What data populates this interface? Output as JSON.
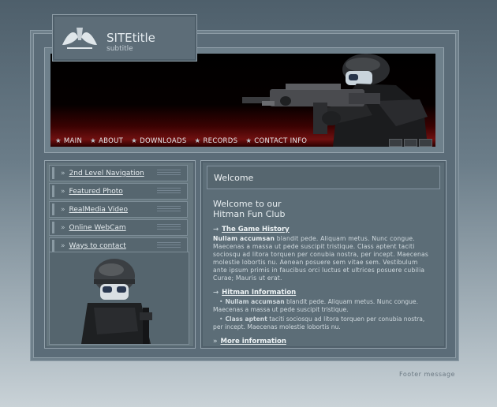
{
  "site": {
    "title": "SITEtitle",
    "subtitle": "subtitle"
  },
  "nav": {
    "items": [
      {
        "label": "MAIN"
      },
      {
        "label": "ABOUT"
      },
      {
        "label": "DOWNLOADS"
      },
      {
        "label": "RECORDS"
      },
      {
        "label": "CONTACT INFO"
      }
    ]
  },
  "sidebar": {
    "items": [
      {
        "label": "2nd Level Navigation"
      },
      {
        "label": "Featured Photo"
      },
      {
        "label": "RealMedia Video"
      },
      {
        "label": "Online WebCam"
      },
      {
        "label": "Ways to contact"
      }
    ]
  },
  "main": {
    "heading": "Welcome",
    "intro_title_line1": "Welcome to our",
    "intro_title_line2": "Hitman Fun Club",
    "section1": {
      "link": "The Game History",
      "bold": "Nullam accumsan",
      "text": " blandit pede. Aliquam metus. Nunc congue. Maecenas a massa ut pede suscipit tristique. Class aptent taciti sociosqu ad litora torquen per conubia nostra, per incept. Maecenas molestie lobortis nu. Aenean posuere sem vitae sem. Vestibulum ante ipsum primis in faucibus orci luctus et ultrices posuere cubilia Curae; Mauris ut erat."
    },
    "section2": {
      "link": "Hitman Information",
      "bullet1_bold": "Nullam accumsan",
      "bullet1_text": " blandit pede. Aliquam metus. Nunc congue. Maecenas a massa ut pede suscipit tristique.",
      "bullet2_bold": "Class aptent",
      "bullet2_text": " taciti sociosqu ad litora torquen per conubia nostra, per incept. Maecenas molestie lobortis nu."
    },
    "more_link": "More information"
  },
  "footer": {
    "message": "Footer message"
  }
}
